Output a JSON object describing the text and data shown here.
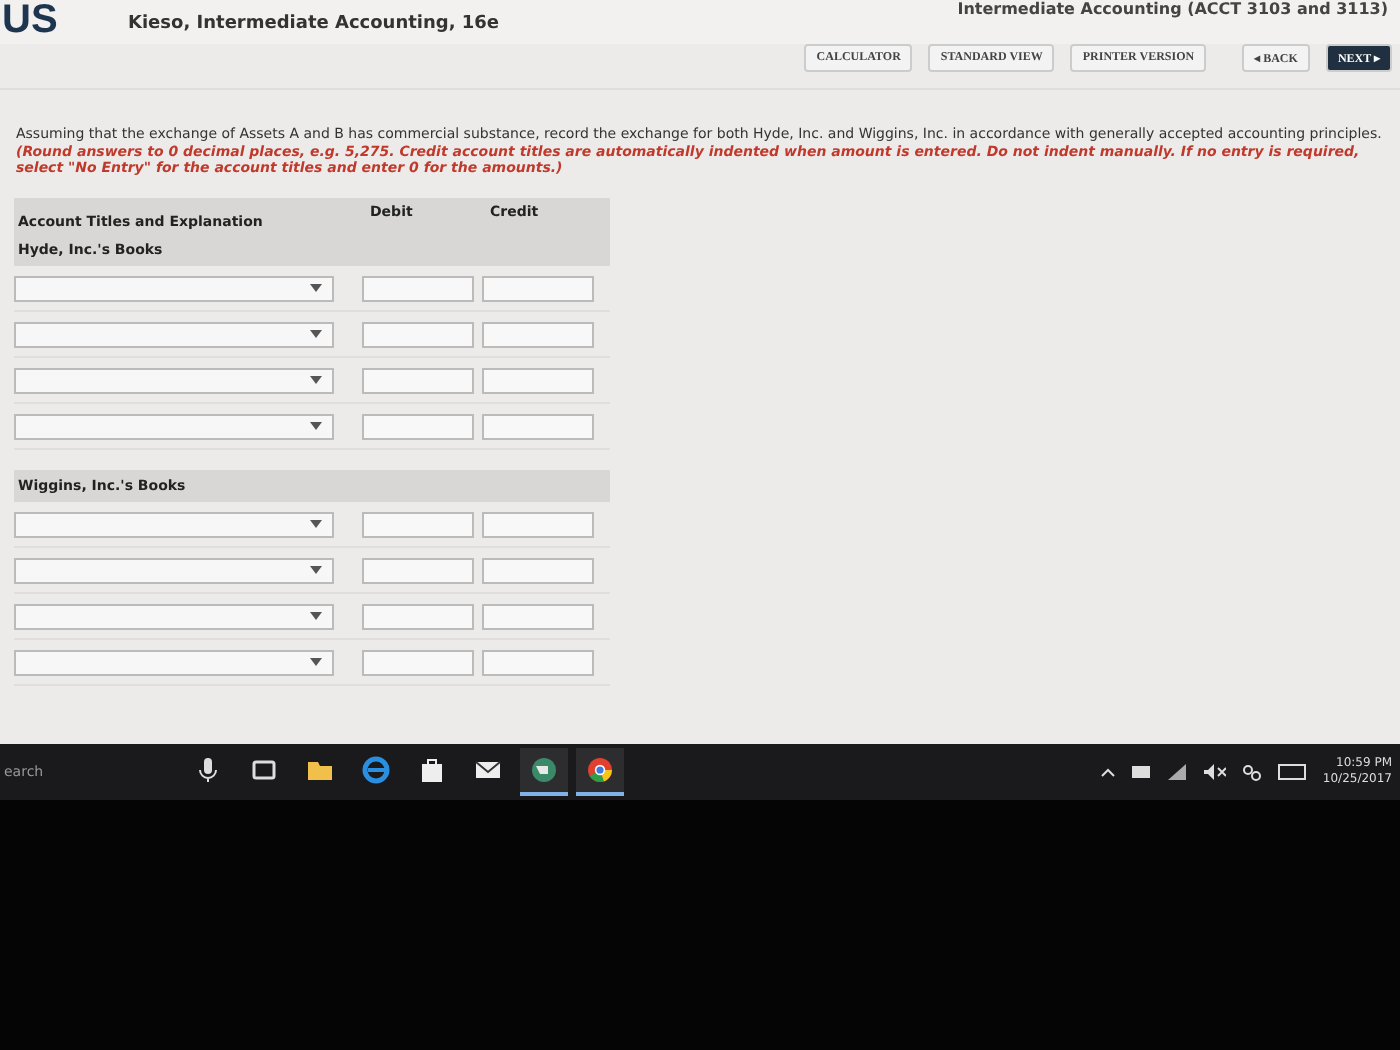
{
  "header": {
    "logo": "US",
    "book_title": "Kieso, Intermediate Accounting, 16e",
    "course": "Intermediate Accounting (ACCT 3103 and 3113)"
  },
  "toolbar": {
    "buttons": [
      "CALCULATOR",
      "STANDARD VIEW",
      "PRINTER VERSION"
    ],
    "back": "◂ BACK",
    "next": "NEXT ▸"
  },
  "instructions": {
    "text": "Assuming that the exchange of Assets A and B has commercial substance, record the exchange for both Hyde, Inc. and Wiggins, Inc. in accordance with generally accepted accounting principles. ",
    "hint": "(Round answers to 0 decimal places, e.g. 5,275. Credit account titles are automatically indented when amount is entered. Do not indent manually. If no entry is required, select \"No Entry\" for the account titles and enter 0 for the amounts.)"
  },
  "table": {
    "columns": [
      "Account Titles and Explanation",
      "Debit",
      "Credit"
    ],
    "sections": [
      {
        "title": "Hyde, Inc.'s Books",
        "rows": [
          {
            "kind": "entry"
          },
          {
            "kind": "entry"
          },
          {
            "kind": "entry"
          },
          {
            "kind": "entry"
          }
        ]
      },
      {
        "title": "Wiggins, Inc.'s Books",
        "rows": [
          {
            "kind": "entry"
          },
          {
            "kind": "entry"
          },
          {
            "kind": "entry"
          },
          {
            "kind": "entry"
          }
        ]
      }
    ]
  },
  "taskbar": {
    "search": "earch",
    "apps": [
      {
        "kind": "mic",
        "active": false
      },
      {
        "kind": "taskview",
        "active": false
      },
      {
        "kind": "folder",
        "active": false
      },
      {
        "kind": "edge",
        "active": false
      },
      {
        "kind": "store",
        "active": false
      },
      {
        "kind": "mail",
        "active": false
      },
      {
        "kind": "globe",
        "active": true
      },
      {
        "kind": "chrome",
        "active": true
      }
    ],
    "time": "10:59 PM",
    "date": "10/25/2017"
  }
}
